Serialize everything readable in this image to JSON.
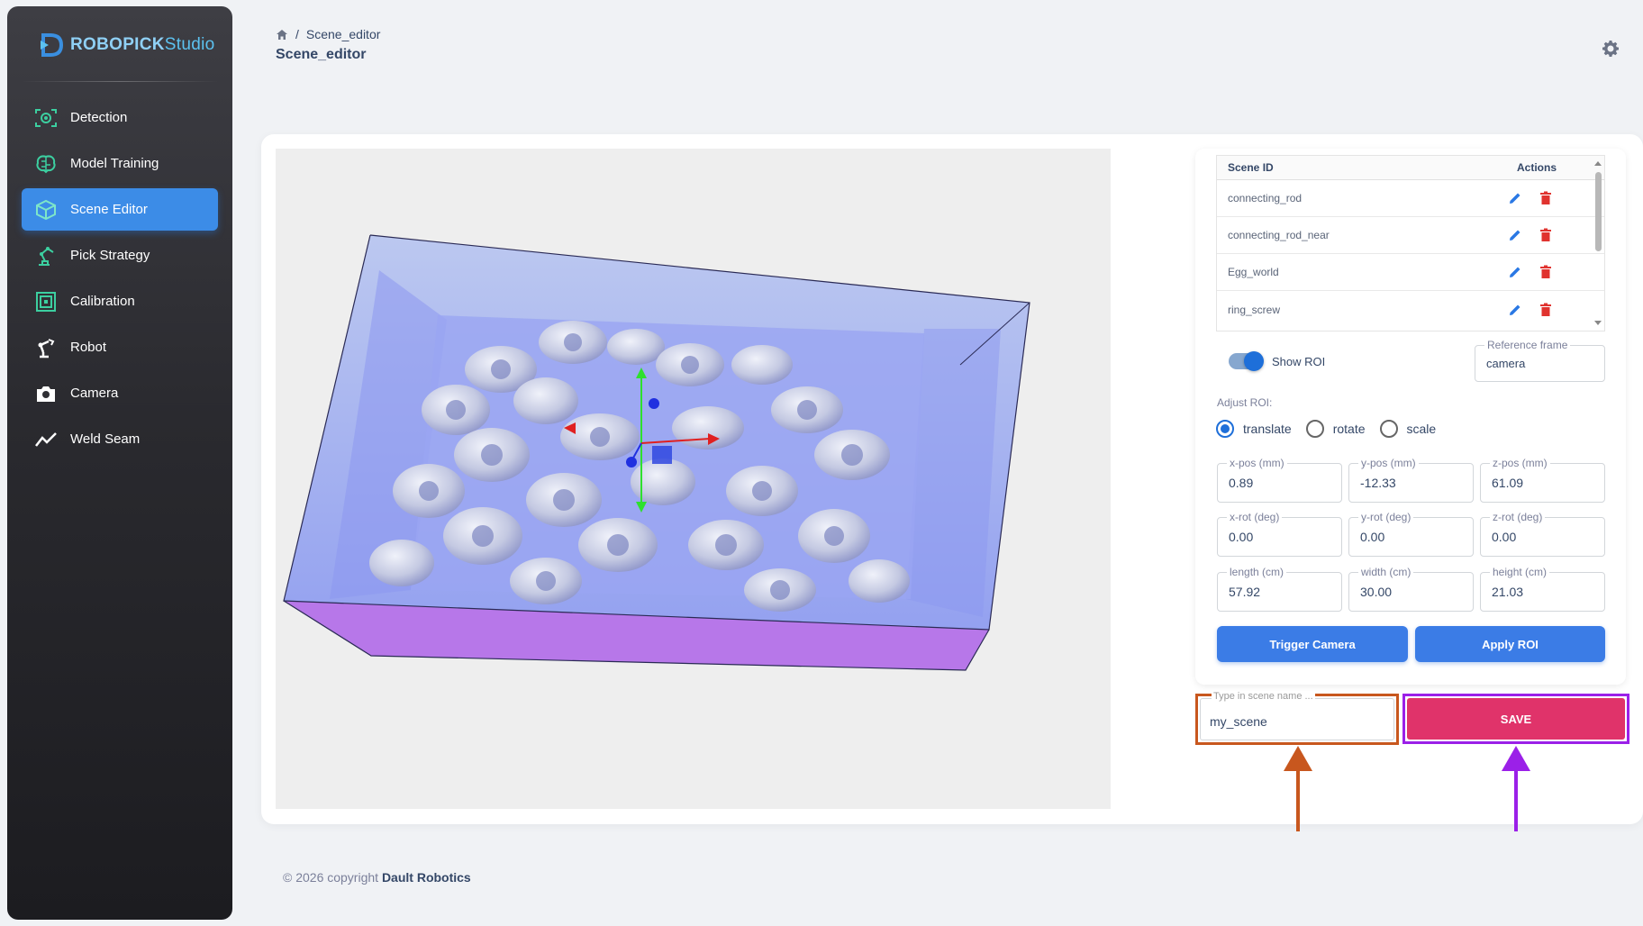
{
  "sidebar": {
    "brand_bold": "ROBOPICK",
    "brand_light": "Studio",
    "items": [
      {
        "label": "Detection",
        "icon": "detection-icon",
        "active": false
      },
      {
        "label": "Model Training",
        "icon": "brain-icon",
        "active": false
      },
      {
        "label": "Scene Editor",
        "icon": "cube-icon",
        "active": true
      },
      {
        "label": "Pick Strategy",
        "icon": "robot-arm-icon",
        "active": false
      },
      {
        "label": "Calibration",
        "icon": "target-icon",
        "active": false
      },
      {
        "label": "Robot",
        "icon": "robot-icon",
        "active": false
      },
      {
        "label": "Camera",
        "icon": "camera-icon",
        "active": false
      },
      {
        "label": "Weld Seam",
        "icon": "trend-line-icon",
        "active": false
      }
    ]
  },
  "header": {
    "breadcrumb_separator": "/",
    "breadcrumb_current": "Scene_editor",
    "title": "Scene_editor"
  },
  "scenes": {
    "col_id": "Scene ID",
    "col_actions": "Actions",
    "rows": [
      "connecting_rod",
      "connecting_rod_near",
      "Egg_world",
      "ring_screw"
    ]
  },
  "roi": {
    "show_roi_label": "Show ROI",
    "show_roi_on": true,
    "reference_frame_label": "Reference frame",
    "reference_frame_value": "camera",
    "adjust_label": "Adjust ROI:",
    "modes": [
      "translate",
      "rotate",
      "scale"
    ],
    "selected_mode": "translate",
    "fields": {
      "x_pos": {
        "label": "x-pos (mm)",
        "value": "0.89"
      },
      "y_pos": {
        "label": "y-pos (mm)",
        "value": "-12.33"
      },
      "z_pos": {
        "label": "z-pos (mm)",
        "value": "61.09"
      },
      "x_rot": {
        "label": "x-rot (deg)",
        "value": "0.00"
      },
      "y_rot": {
        "label": "y-rot (deg)",
        "value": "0.00"
      },
      "z_rot": {
        "label": "z-rot (deg)",
        "value": "0.00"
      },
      "length": {
        "label": "length (cm)",
        "value": "57.92"
      },
      "width": {
        "label": "width (cm)",
        "value": "30.00"
      },
      "height": {
        "label": "height (cm)",
        "value": "21.03"
      }
    },
    "trigger_label": "Trigger Camera",
    "apply_label": "Apply ROI"
  },
  "save": {
    "name_placeholder": "Type in scene name ...",
    "name_value": "my_scene",
    "save_label": "SAVE"
  },
  "footer": {
    "prefix": "© 2026 copyright",
    "company": "Dault Robotics"
  },
  "colors": {
    "accent": "#3b7ce6",
    "save": "#e0336a",
    "highlight_name": "#c8571e",
    "highlight_save": "#9b20e8"
  }
}
